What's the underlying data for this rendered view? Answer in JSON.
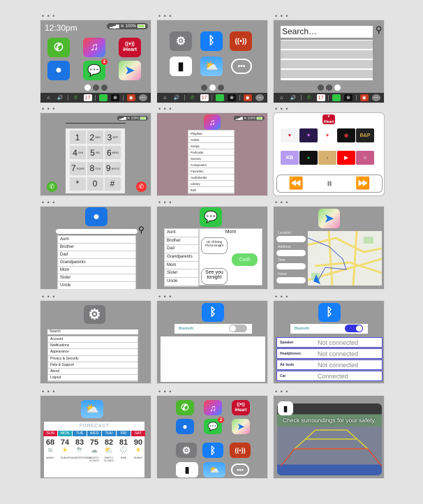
{
  "home1": {
    "time": "12:30pm",
    "status": {
      "signal": "▂▄▆█",
      "wifi": "wifi",
      "battery": "100%"
    },
    "apps": [
      {
        "name": "phone",
        "glyph": "✆"
      },
      {
        "name": "music",
        "glyph": "♫"
      },
      {
        "name": "iheart",
        "glyph": "((♥))",
        "label": "iHeart"
      },
      {
        "name": "contacts",
        "glyph": "👤"
      },
      {
        "name": "messages",
        "glyph": "💬",
        "badge": "2"
      },
      {
        "name": "maps",
        "glyph": "➤"
      }
    ],
    "page_index": 0
  },
  "home2": {
    "apps": [
      {
        "name": "settings",
        "glyph": "⚙"
      },
      {
        "name": "bluetooth",
        "glyph": "ᛒ"
      },
      {
        "name": "radio",
        "glyph": "((•))"
      },
      {
        "name": "car-camera",
        "glyph": "▮"
      },
      {
        "name": "weather",
        "glyph": "⛅"
      },
      {
        "name": "more",
        "glyph": "•••"
      }
    ],
    "page_index": 1
  },
  "home3": {
    "search_placeholder": "Search…",
    "page_index": 2
  },
  "dock": {
    "items": [
      "home",
      "volume",
      "phone",
      "calendar",
      "messages",
      "camera",
      "radio",
      "more"
    ],
    "calendar_day": "17"
  },
  "dialer": {
    "keys": [
      {
        "d": "1",
        "l": ""
      },
      {
        "d": "2",
        "l": "ABC"
      },
      {
        "d": "3",
        "l": "DEF"
      },
      {
        "d": "4",
        "l": "GHI"
      },
      {
        "d": "5",
        "l": "JKL"
      },
      {
        "d": "6",
        "l": "MNO"
      },
      {
        "d": "7",
        "l": "PQRS"
      },
      {
        "d": "8",
        "l": "TUV"
      },
      {
        "d": "9",
        "l": "WXYZ"
      },
      {
        "d": "*",
        "l": ""
      },
      {
        "d": "0",
        "l": ""
      },
      {
        "d": "#",
        "l": ""
      }
    ]
  },
  "music": {
    "menu": [
      "Playlists",
      "Artists",
      "Songs",
      "Podcasts",
      "Genres",
      "Composers",
      "Favorites",
      "Audiobooks",
      "Library",
      "Edit"
    ]
  },
  "iheart": {
    "logo": "iHeart",
    "stations": [
      {
        "name": "iHeart Family",
        "bg": "#f4f4f4",
        "fg": "#c8102e",
        "glyph": "♥"
      },
      {
        "name": "Neon",
        "bg": "#2a1a4a",
        "fg": "#e070ff",
        "glyph": "✦"
      },
      {
        "name": "Pride",
        "bg": "#fff",
        "fg": "#e33",
        "glyph": "♥"
      },
      {
        "name": "Dark Station",
        "bg": "#111",
        "fg": "#c33",
        "glyph": "◉"
      },
      {
        "name": "B&P",
        "bg": "#222",
        "fg": "#d9a84a",
        "glyph": "B&P"
      },
      {
        "name": "Kidz Bop",
        "bg": "#b59cf0",
        "fg": "#fff",
        "glyph": "KB"
      },
      {
        "name": "Spotify",
        "bg": "#111",
        "fg": "#1db954",
        "glyph": "●"
      },
      {
        "name": "Album",
        "bg": "#d8b070",
        "fg": "#553",
        "glyph": "♪"
      },
      {
        "name": "YouTube",
        "bg": "#f00",
        "fg": "#fff",
        "glyph": "▶"
      },
      {
        "name": "Artist",
        "bg": "#c85a8a",
        "fg": "#fff",
        "glyph": "☺"
      }
    ],
    "controls": {
      "prev": "⏪",
      "pause": "⏸",
      "next": "⏩"
    }
  },
  "contacts": {
    "list": [
      "Aunt",
      "Brother",
      "Dad",
      "Grandparents",
      "Mom",
      "Sister",
      "Uncle"
    ]
  },
  "messages": {
    "contacts": [
      "Aunt",
      "Brother",
      "Dad",
      "Grandparents",
      "Mom",
      "Sister",
      "Uncle"
    ],
    "thread_title": "Mom",
    "bubbles": [
      {
        "from": "them",
        "text": "Hi! I'll bring Pizza tonight"
      },
      {
        "from": "me",
        "text": "Cool!"
      },
      {
        "from": "them",
        "text": "See you tonight"
      }
    ]
  },
  "maps": {
    "fields": [
      "Location",
      "Address",
      "Time",
      "Home"
    ]
  },
  "settings": {
    "search_label": "Search",
    "items": [
      "Account",
      "Notifications",
      "Appearance",
      "Privacy & Security",
      "Help & Support",
      "About",
      "Logout"
    ]
  },
  "bluetooth_off": {
    "label": "Bluetooth",
    "enabled": false
  },
  "bluetooth_on": {
    "label": "Bluetooth",
    "enabled": true,
    "devices": [
      {
        "name": "Speaker",
        "status": "Not connected"
      },
      {
        "name": "Headphones",
        "status": "Not connected"
      },
      {
        "name": "Air buds",
        "status": "Not connected"
      },
      {
        "name": "Car",
        "status": "Connected"
      }
    ]
  },
  "weather": {
    "title": "FORECAST",
    "days": [
      {
        "day": "SUN",
        "temp": "68",
        "icon": "≋",
        "cond": "WINDY",
        "color": "#d9173c"
      },
      {
        "day": "MON",
        "temp": "74",
        "icon": "☀",
        "cond": "SUNNY",
        "color": "#1fa8b8"
      },
      {
        "day": "TUE",
        "temp": "83",
        "icon": "⛈",
        "cond": "THUNDERSTORMS",
        "color": "#2a84c9"
      },
      {
        "day": "WED",
        "temp": "75",
        "icon": "☁",
        "cond": "MOSTLY CLOUDY",
        "color": "#2a84c9"
      },
      {
        "day": "THU",
        "temp": "82",
        "icon": "⛅",
        "cond": "PARTLY CLOUDY",
        "color": "#2a84c9"
      },
      {
        "day": "FRI",
        "temp": "81",
        "icon": "🌧",
        "cond": "RAIN",
        "color": "#2a84c9"
      },
      {
        "day": "SAT",
        "temp": "90",
        "icon": "☀",
        "cond": "SUNNY",
        "color": "#d9173c"
      }
    ]
  },
  "all_apps": {
    "apps": [
      "phone",
      "music",
      "iheart",
      "contacts",
      "messages",
      "maps",
      "settings",
      "bluetooth",
      "radio",
      "car-camera",
      "weather",
      "more"
    ]
  },
  "camera": {
    "caption": "Check surroundings for your safety."
  }
}
